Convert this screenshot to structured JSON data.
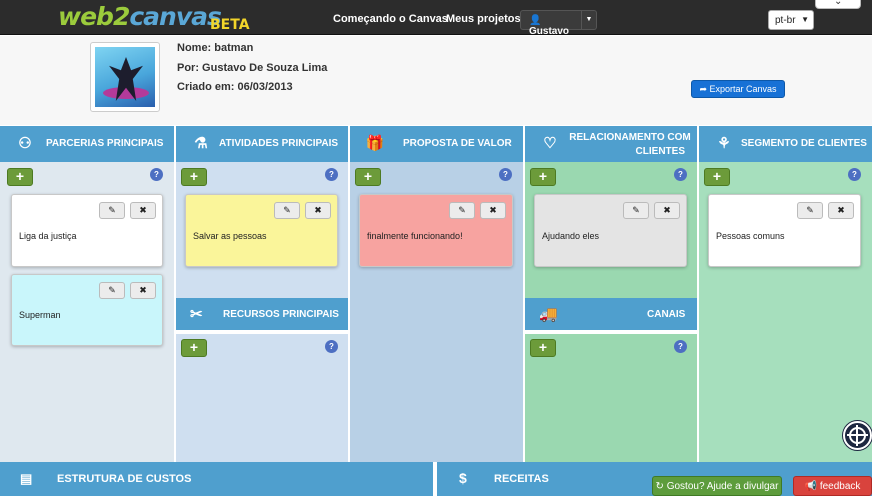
{
  "brand": {
    "logo_a": "web2",
    "logo_b": "canvas",
    "beta": "BETA"
  },
  "nav": {
    "getting_started": "Começando o Canvas",
    "my_projects": "Meus projetos",
    "user": "Gustavo",
    "language": "pt-br"
  },
  "project": {
    "name": "Nome: batman",
    "author": "Por: Gustavo De Souza Lima",
    "created": "Criado em: 06/03/2013",
    "export_label": "Exportar Canvas"
  },
  "columns": {
    "partners": {
      "title": "PARCERIAS PRINCIPAIS",
      "bg": "#dfe8ef"
    },
    "activities": {
      "title": "ATIVIDADES PRINCIPAIS",
      "bg": "#cfdff0"
    },
    "resources": {
      "title": "RECURSOS PRINCIPAIS"
    },
    "value": {
      "title": "PROPOSTA DE VALOR",
      "bg": "#b8d0e6"
    },
    "relationship": {
      "title_line1": "RELACIONAMENTO COM",
      "title_line2": "CLIENTES",
      "bg": "#9ad8b0"
    },
    "channels": {
      "title": "CANAIS"
    },
    "segments": {
      "title": "SEGMENTO DE CLIENTES",
      "bg": "#a6dfbd"
    }
  },
  "cards": {
    "c1": {
      "text": "Liga da justiça",
      "color": "#ffffff"
    },
    "c2": {
      "text": "Superman",
      "color": "#c9f6fb"
    },
    "c3": {
      "text": "Salvar as pessoas",
      "color": "#faf59a"
    },
    "c4": {
      "text": "finalmente funcionando!",
      "color": "#f7a3a0"
    },
    "c5": {
      "text": "Ajudando eles",
      "color": "#e4e4e4"
    },
    "c6": {
      "text": "Pessoas comuns",
      "color": "#ffffff"
    }
  },
  "buttons": {
    "add": "+",
    "help": "?",
    "edit": "✎",
    "delete": "✖"
  },
  "footer": {
    "costs": "ESTRUTURA DE CUSTOS",
    "revenue": "RECEITAS",
    "share": "Gostou? Ajude a divulgar",
    "feedback": "feedback"
  },
  "icons": {
    "partners": "handshake-icon",
    "activities": "flask-icon",
    "value": "gift-icon",
    "relationship": "heart-icon",
    "segments": "sitemap-icon",
    "resources": "tools-icon",
    "channels": "truck-icon",
    "costs": "coins-icon",
    "revenue": "dollar-icon"
  }
}
